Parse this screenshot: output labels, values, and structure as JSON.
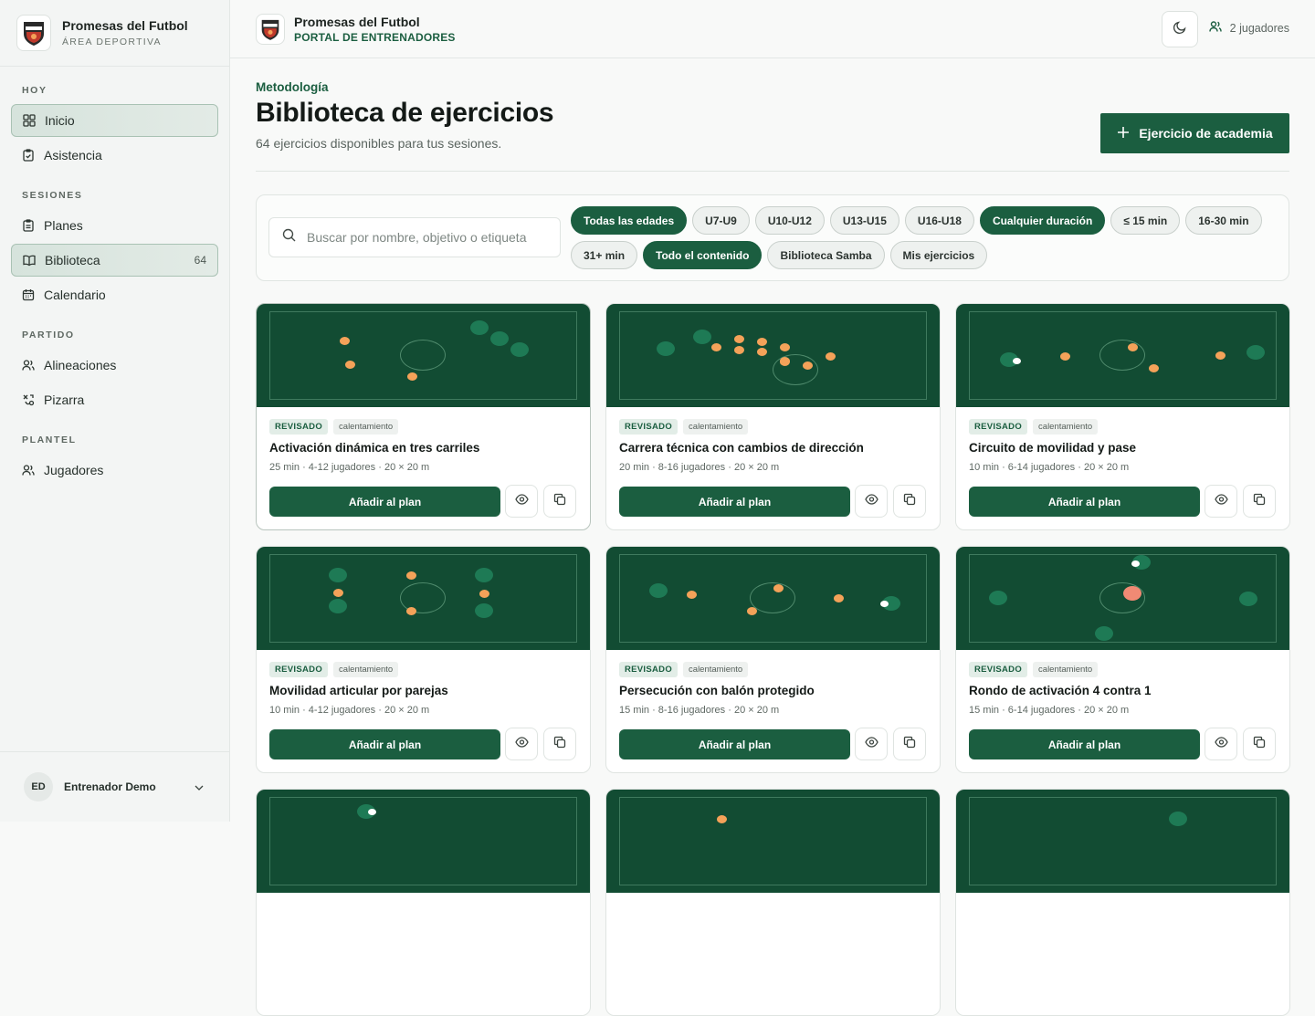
{
  "brand": {
    "name": "Promesas del Futbol",
    "subtitle": "ÁREA DEPORTIVA"
  },
  "sidebar": {
    "sections": [
      {
        "label": "HOY"
      },
      {
        "label": "SESIONES"
      },
      {
        "label": "PARTIDO"
      },
      {
        "label": "PLANTEL"
      }
    ],
    "items": [
      {
        "label": "Inicio",
        "icon": "grid-icon",
        "active": true
      },
      {
        "label": "Asistencia",
        "icon": "clipboard-check-icon"
      },
      {
        "label": "Planes",
        "icon": "clipboard-icon"
      },
      {
        "label": "Biblioteca",
        "icon": "book-icon",
        "active": true,
        "count": "64"
      },
      {
        "label": "Calendario",
        "icon": "calendar-icon"
      },
      {
        "label": "Alineaciones",
        "icon": "users-icon"
      },
      {
        "label": "Pizarra",
        "icon": "tactics-icon"
      },
      {
        "label": "Jugadores",
        "icon": "users-icon"
      }
    ],
    "user": {
      "initials": "ED",
      "name": "Entrenador Demo"
    }
  },
  "topbar": {
    "name": "Promesas del Futbol",
    "subtitle": "PORTAL DE ENTRENADORES",
    "players": "2 jugadores"
  },
  "header": {
    "eyebrow": "Metodología",
    "title": "Biblioteca de ejercicios",
    "subtitle": "64 ejercicios disponibles para tus sesiones.",
    "add_button": "Ejercicio de academia"
  },
  "filters": {
    "search_placeholder": "Buscar por nombre, objetivo o etiqueta",
    "chips": [
      {
        "label": "Todas las edades",
        "on": true
      },
      {
        "label": "U7-U9"
      },
      {
        "label": "U10-U12"
      },
      {
        "label": "U13-U15"
      },
      {
        "label": "U16-U18"
      },
      {
        "label": "Cualquier duración",
        "on": true
      },
      {
        "label": "≤ 15 min"
      },
      {
        "label": "16-30 min"
      },
      {
        "label": "31+ min"
      },
      {
        "label": "Todo el contenido",
        "on": true
      },
      {
        "label": "Biblioteca Samba"
      },
      {
        "label": "Mis ejercicios"
      }
    ]
  },
  "colors": {
    "primary": "#1b5e40",
    "pitch": "#124c33",
    "orange": "#f4a259",
    "team": "#1e7a55",
    "salmon": "#f08a74"
  },
  "cards": [
    {
      "status": "REVISADO",
      "category": "calentamiento",
      "title": "Activación dinámica en tres carriles",
      "meta": "25 min · 4-12 jugadores · 20 × 20 m",
      "add": "Añadir al plan"
    },
    {
      "status": "REVISADO",
      "category": "calentamiento",
      "title": "Carrera técnica con cambios de dirección",
      "meta": "20 min · 8-16 jugadores · 20 × 20 m",
      "add": "Añadir al plan"
    },
    {
      "status": "REVISADO",
      "category": "calentamiento",
      "title": "Circuito de movilidad y pase",
      "meta": "10 min · 6-14 jugadores · 20 × 20 m",
      "add": "Añadir al plan"
    },
    {
      "status": "REVISADO",
      "category": "calentamiento",
      "title": "Movilidad articular por parejas",
      "meta": "10 min · 4-12 jugadores · 20 × 20 m",
      "add": "Añadir al plan"
    },
    {
      "status": "REVISADO",
      "category": "calentamiento",
      "title": "Persecución con balón protegido",
      "meta": "15 min · 8-16 jugadores · 20 × 20 m",
      "add": "Añadir al plan"
    },
    {
      "status": "REVISADO",
      "category": "calentamiento",
      "title": "Rondo de activación 4 contra 1",
      "meta": "15 min · 6-14 jugadores · 20 × 20 m",
      "add": "Añadir al plan"
    }
  ]
}
